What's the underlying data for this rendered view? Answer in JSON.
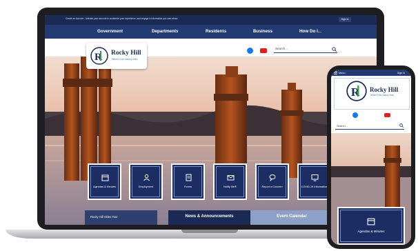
{
  "site": {
    "alert_text": "Create an Account - Activate your account to customize your experience, and engage in information you care about.",
    "sign_in_label": "Sign In",
    "nav": [
      "Government",
      "Departments",
      "Residents",
      "Business",
      "How Do I..."
    ],
    "logo_name": "Rocky Hill",
    "logo_tagline": "Where river history lives",
    "search_placeholder": "Search...",
    "quick_links": [
      "Agendas & Minutes",
      "Employment",
      "Forms",
      "Notify Me®",
      "Report a Concern",
      "COVID-19 Information"
    ],
    "video_tour_label": "Rocky Hill Video Tour",
    "tabs": [
      "News & Announcements",
      "Event Calendar"
    ]
  },
  "phone": {
    "menu_label": "Menu",
    "sign_in_label": "Sign In",
    "logo_name": "Rocky Hill",
    "logo_tagline": "Where river history lives",
    "search_placeholder": "Search...",
    "quick_link": "Agendas & Minutes"
  },
  "colors": {
    "navy": "#1b2a55",
    "nav_blue": "#233a73",
    "tile_blue": "#1c2d63",
    "light_tab": "#8da0c8",
    "facebook": "#1877f2",
    "youtube": "#e02020"
  },
  "icons": [
    "hamburger-icon",
    "search-icon",
    "facebook-icon",
    "youtube-icon",
    "calendar-icon",
    "person-icon",
    "document-icon",
    "envelope-icon",
    "chat-icon",
    "monitor-icon"
  ]
}
